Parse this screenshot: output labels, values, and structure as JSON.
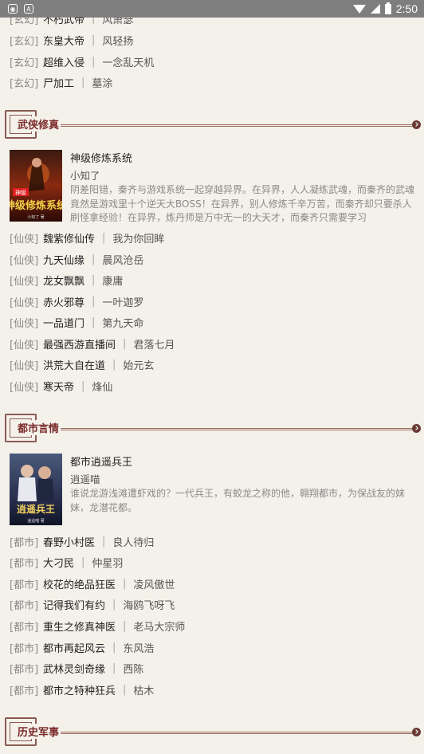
{
  "status_bar": {
    "time": "2:50"
  },
  "sections": {
    "xuanhuan_tail": [
      {
        "cat": "[玄幻]",
        "title": "不朽武帝",
        "author": "风萧瑟"
      },
      {
        "cat": "[玄幻]",
        "title": "东皇大帝",
        "author": "风轻扬"
      },
      {
        "cat": "[玄幻]",
        "title": "超维入侵",
        "author": "一念乱天机"
      },
      {
        "cat": "[玄幻]",
        "title": "尸加工",
        "author": "墓涂"
      }
    ],
    "wuxia": {
      "label": "武侠修真",
      "feature": {
        "title": "神级修炼系统",
        "author": "小知了",
        "desc": "阴差阳错，秦齐与游戏系统一起穿越异界。在异界，人人凝练武魂，而秦齐的武魂竟然是游戏里十个逆天大BOSS！在异界，别人修炼千辛万苦，而秦齐却只要杀人刷怪拿经验！在异界，炼丹师是万中无一的大天才，而秦齐只需要学习",
        "cover_text": "神级修炼系统",
        "cover_sub": "小知了 著"
      },
      "items": [
        {
          "cat": "[仙侠]",
          "title": "魏紫修仙传",
          "author": "我为你回眸"
        },
        {
          "cat": "[仙侠]",
          "title": "九天仙缘",
          "author": "晨风沧岳"
        },
        {
          "cat": "[仙侠]",
          "title": "龙女飘飘",
          "author": "康庸"
        },
        {
          "cat": "[仙侠]",
          "title": "赤火邪尊",
          "author": "一叶迦罗"
        },
        {
          "cat": "[仙侠]",
          "title": "一品道门",
          "author": "第九天命"
        },
        {
          "cat": "[仙侠]",
          "title": "最强西游直播间",
          "author": "君落七月"
        },
        {
          "cat": "[仙侠]",
          "title": "洪荒大自在道",
          "author": "始元玄"
        },
        {
          "cat": "[仙侠]",
          "title": "寒天帝",
          "author": "烽仙"
        }
      ]
    },
    "dushi": {
      "label": "都市言情",
      "feature": {
        "title": "都市逍遥兵王",
        "author": "逍遥喵",
        "desc": "谁说龙游浅滩遭虾戏的？一代兵王，有蛟龙之称的他，翱翔都市，为保战友的妹妹，龙潜花都。",
        "cover_text": "逍遥兵王",
        "cover_sub": "逍遥喵 著"
      },
      "items": [
        {
          "cat": "[都市]",
          "title": "春野小村医",
          "author": "良人待归"
        },
        {
          "cat": "[都市]",
          "title": "大刁民",
          "author": "仲星羽"
        },
        {
          "cat": "[都市]",
          "title": "校花的绝品狂医",
          "author": "凌风傲世"
        },
        {
          "cat": "[都市]",
          "title": "记得我们有约",
          "author": "海鸥飞呀飞"
        },
        {
          "cat": "[都市]",
          "title": "重生之修真神医",
          "author": "老马大宗师"
        },
        {
          "cat": "[都市]",
          "title": "都市再起风云",
          "author": "东风浩"
        },
        {
          "cat": "[都市]",
          "title": "武林灵剑奇缘",
          "author": "西陈"
        },
        {
          "cat": "[都市]",
          "title": "都市之特种狂兵",
          "author": "枯木"
        }
      ]
    },
    "lishi": {
      "label": "历史军事"
    }
  },
  "separator": "|",
  "colors": {
    "accent": "#7a2b2b",
    "background": "#f4f1ea"
  }
}
